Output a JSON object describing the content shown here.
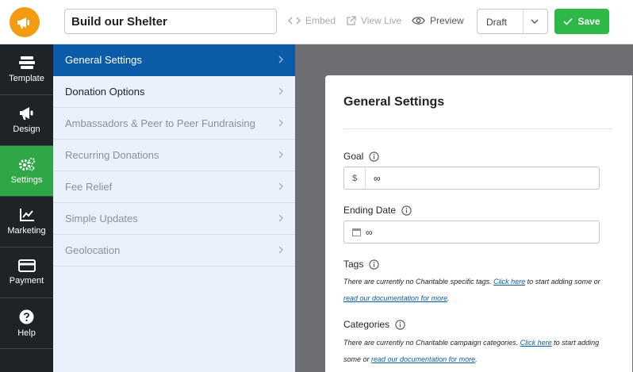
{
  "header": {
    "campaign_title": "Build our Shelter",
    "embed_label": "Embed",
    "view_live_label": "View Live",
    "preview_label": "Preview",
    "status_value": "Draft",
    "save_label": "Save",
    "accent_color": "#2eb845"
  },
  "rail": {
    "items": [
      {
        "label": "Template",
        "icon": "template-icon"
      },
      {
        "label": "Design",
        "icon": "megaphone-icon"
      },
      {
        "label": "Settings",
        "icon": "gears-icon",
        "active": true
      },
      {
        "label": "Marketing",
        "icon": "chart-icon"
      },
      {
        "label": "Payment",
        "icon": "credit-card-icon"
      },
      {
        "label": "Help",
        "icon": "help-icon"
      }
    ]
  },
  "submenu": {
    "items": [
      {
        "label": "General Settings",
        "active": true
      },
      {
        "label": "Donation Options"
      },
      {
        "label": "Ambassadors & Peer to Peer Fundraising"
      },
      {
        "label": "Recurring Donations"
      },
      {
        "label": "Fee Relief"
      },
      {
        "label": "Simple Updates"
      },
      {
        "label": "Geolocation"
      }
    ]
  },
  "panel": {
    "title": "General Settings",
    "goal": {
      "label": "Goal",
      "prefix": "$",
      "value": "∞"
    },
    "ending_date": {
      "label": "Ending Date",
      "value": "∞"
    },
    "tags": {
      "label": "Tags",
      "text_before": "There are currently no Charitable specific tags. ",
      "link1": "Click here",
      "text_middle": " to start adding some or ",
      "link2": "read our documentation for more",
      "text_after": "."
    },
    "categories": {
      "label": "Categories",
      "text_before": "There are currently no Charitable campaign categories. ",
      "link1": "Click here",
      "text_middle": " to start adding some or ",
      "link2": "read our documentation for more",
      "text_after": "."
    }
  }
}
